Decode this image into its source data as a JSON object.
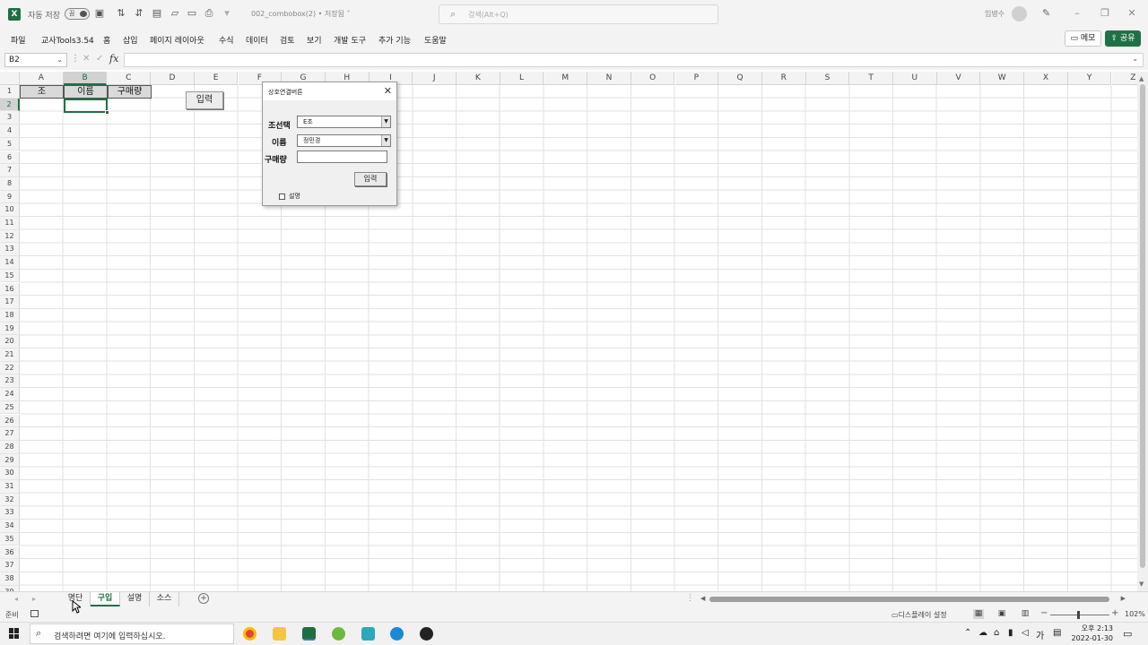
{
  "titlebar": {
    "app_icon": "excel-icon",
    "autosave_label": "자동 저장",
    "autosave_toggle": "끔",
    "filename": "002_combobox(2) • 저장됨 ˅",
    "search_placeholder": "검색(Alt+Q)",
    "username": "임병수"
  },
  "ribbon": {
    "tabs": [
      "파일",
      "교사Tools3.54",
      "홈",
      "삽입",
      "페이지 레이아웃",
      "수식",
      "데이터",
      "검토",
      "보기",
      "개발 도구",
      "추가 기능",
      "도움말"
    ],
    "memo_label": "메모",
    "share_label": "공유",
    "accent": "#1e7145"
  },
  "formula_bar": {
    "name_box": "B2",
    "fx": "fx",
    "value": ""
  },
  "sheet": {
    "columns": [
      "A",
      "B",
      "C",
      "D",
      "E",
      "F",
      "G",
      "H",
      "I",
      "J",
      "K",
      "L",
      "M",
      "N",
      "O",
      "P",
      "Q",
      "R",
      "S",
      "T",
      "U",
      "V",
      "W",
      "X",
      "Y",
      "Z"
    ],
    "rows": [
      "1",
      "2",
      "3",
      "4",
      "5",
      "6",
      "7",
      "8",
      "9",
      "10",
      "11",
      "12",
      "13",
      "14",
      "15",
      "16",
      "17",
      "18",
      "19",
      "20",
      "21",
      "22",
      "23",
      "24",
      "25",
      "26",
      "27",
      "28",
      "29",
      "30",
      "31",
      "32",
      "33",
      "34",
      "35",
      "36",
      "37",
      "38",
      "39"
    ],
    "header_cells": [
      "조",
      "이름",
      "구매량"
    ],
    "input_button": "입력"
  },
  "dialog": {
    "title": "상호연결버튼",
    "close": "✕",
    "label_group": "조선택",
    "group_value": "E조",
    "label_name": "이름",
    "name_value": "정민경",
    "label_qty": "구매량",
    "qty_value": "",
    "input_button": "입력",
    "checkbox_label": "설명"
  },
  "sheet_tabs": [
    "명단",
    "구입",
    "설명",
    "소스"
  ],
  "active_sheet": "구입",
  "status": {
    "ready": "준비",
    "display_settings": "디스플레이 설정",
    "zoom": "102%",
    "zoom_value": 102
  },
  "taskbar": {
    "search_placeholder": "검색하려면 여기에 입력하십시오.",
    "ime": "가",
    "time": "오후 2:13",
    "date": "2022-01-30"
  }
}
